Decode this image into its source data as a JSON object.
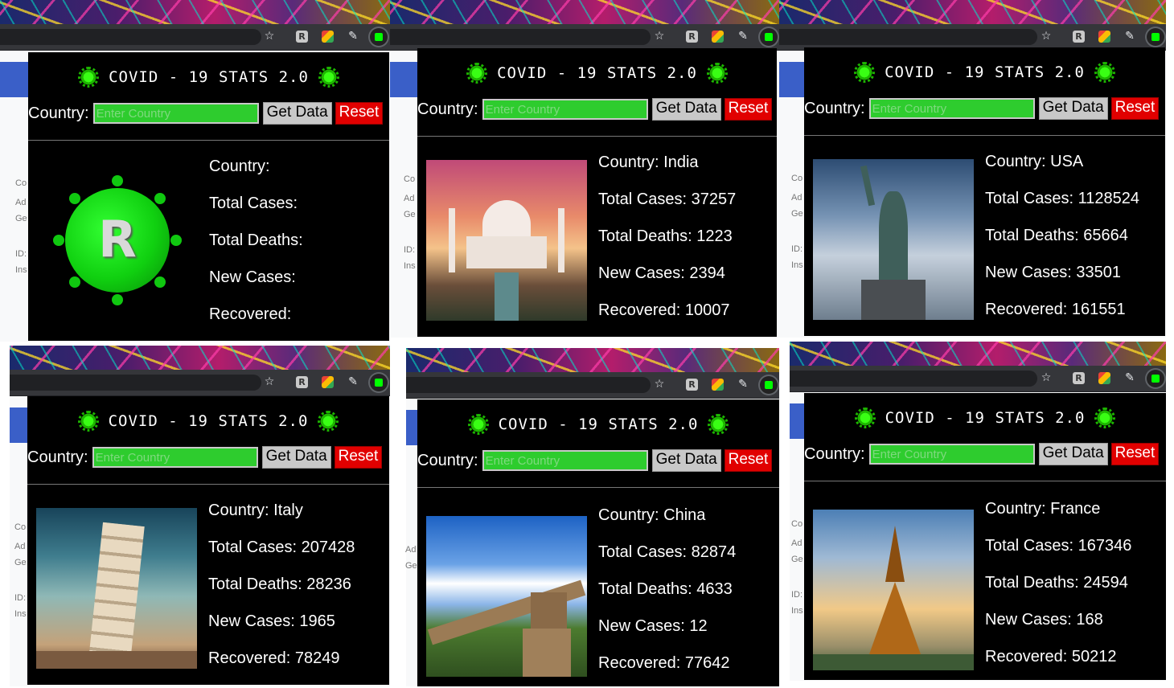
{
  "app": {
    "title": "COVID - 19 STATS 2.0",
    "country_label": "Country:",
    "input_placeholder": "Enter Country",
    "get_data_label": "Get Data",
    "reset_label": "Reset",
    "stat_labels": {
      "country": "Country:",
      "total_cases": "Total Cases:",
      "total_deaths": "Total Deaths:",
      "new_cases": "New Cases:",
      "recovered": "Recovered:"
    }
  },
  "browser": {
    "star_icon": "☆",
    "ext_r_icon": "R"
  },
  "background_page": {
    "lines": [
      "Co",
      "Ad",
      "Ge",
      "ID:",
      "Ins"
    ]
  },
  "panels": [
    {
      "image": "covid-logo",
      "country": "",
      "total_cases": "",
      "total_deaths": "",
      "new_cases": "",
      "recovered": "",
      "lines": [
        "Country:",
        "Total Cases:",
        "Total Deaths:",
        "New Cases:",
        "Recovered:"
      ]
    },
    {
      "image": "taj-mahal",
      "country": "India",
      "total_cases": "37257",
      "total_deaths": "1223",
      "new_cases": "2394",
      "recovered": "10007",
      "lines": [
        "Country: India",
        "Total Cases: 37257",
        "Total Deaths: 1223",
        "New Cases: 2394",
        "Recovered: 10007"
      ]
    },
    {
      "image": "statue-of-liberty",
      "country": "USA",
      "total_cases": "1128524",
      "total_deaths": "65664",
      "new_cases": "33501",
      "recovered": "161551",
      "lines": [
        "Country: USA",
        "Total Cases: 1128524",
        "Total Deaths: 65664",
        "New Cases: 33501",
        "Recovered: 161551"
      ]
    },
    {
      "image": "leaning-tower-of-pisa",
      "country": "Italy",
      "total_cases": "207428",
      "total_deaths": "28236",
      "new_cases": "1965",
      "recovered": "78249",
      "lines": [
        "Country: Italy",
        "Total Cases: 207428",
        "Total Deaths: 28236",
        "New Cases: 1965",
        "Recovered: 78249"
      ]
    },
    {
      "image": "great-wall",
      "country": "China",
      "total_cases": "82874",
      "total_deaths": "4633",
      "new_cases": "12",
      "recovered": "77642",
      "lines": [
        "Country: China",
        "Total Cases: 82874",
        "Total Deaths: 4633",
        "New Cases: 12",
        "Recovered: 77642"
      ]
    },
    {
      "image": "eiffel-tower",
      "country": "France",
      "total_cases": "167346",
      "total_deaths": "24594",
      "new_cases": "168",
      "recovered": "50212",
      "lines": [
        "Country: France",
        "Total Cases: 167346",
        "Total Deaths: 24594",
        "New Cases: 168",
        "Recovered: 50212"
      ]
    }
  ],
  "colors": {
    "popup_bg": "#000000",
    "input_bg": "#2ecc2e",
    "reset_bg": "#e10000",
    "get_data_bg": "#c8c8c8",
    "virus_green": "#1db600"
  }
}
